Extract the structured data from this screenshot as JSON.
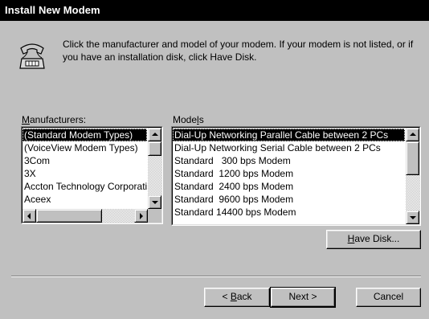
{
  "window": {
    "title": "Install New Modem"
  },
  "instruction": "Click the manufacturer and model of your modem. If your modem is not listed, or if you have an installation disk, click Have Disk.",
  "manufacturers": {
    "label_mnemonic": "M",
    "label_rest": "anufacturers:",
    "items": [
      "(Standard Modem Types)",
      "(VoiceView Modem Types)",
      "3Com",
      "3X",
      "Accton Technology Corporation",
      "Aceex"
    ],
    "selected_index": 0
  },
  "models": {
    "label_before": "Mode",
    "label_mnemonic": "l",
    "label_after": "s",
    "items": [
      "Dial-Up Networking Parallel Cable between 2 PCs",
      "Dial-Up Networking Serial Cable between 2 PCs",
      "Standard   300 bps Modem",
      "Standard  1200 bps Modem",
      "Standard  2400 bps Modem",
      "Standard  9600 bps Modem",
      "Standard 14400 bps Modem"
    ],
    "selected_index": 0
  },
  "buttons": {
    "have_disk": {
      "mnemonic": "H",
      "rest": "ave Disk..."
    },
    "back": {
      "prefix": "< ",
      "mnemonic": "B",
      "rest": "ack"
    },
    "next": "Next >",
    "cancel": "Cancel"
  },
  "icons": {
    "dialog_icon": "telephone-modem-icon"
  }
}
